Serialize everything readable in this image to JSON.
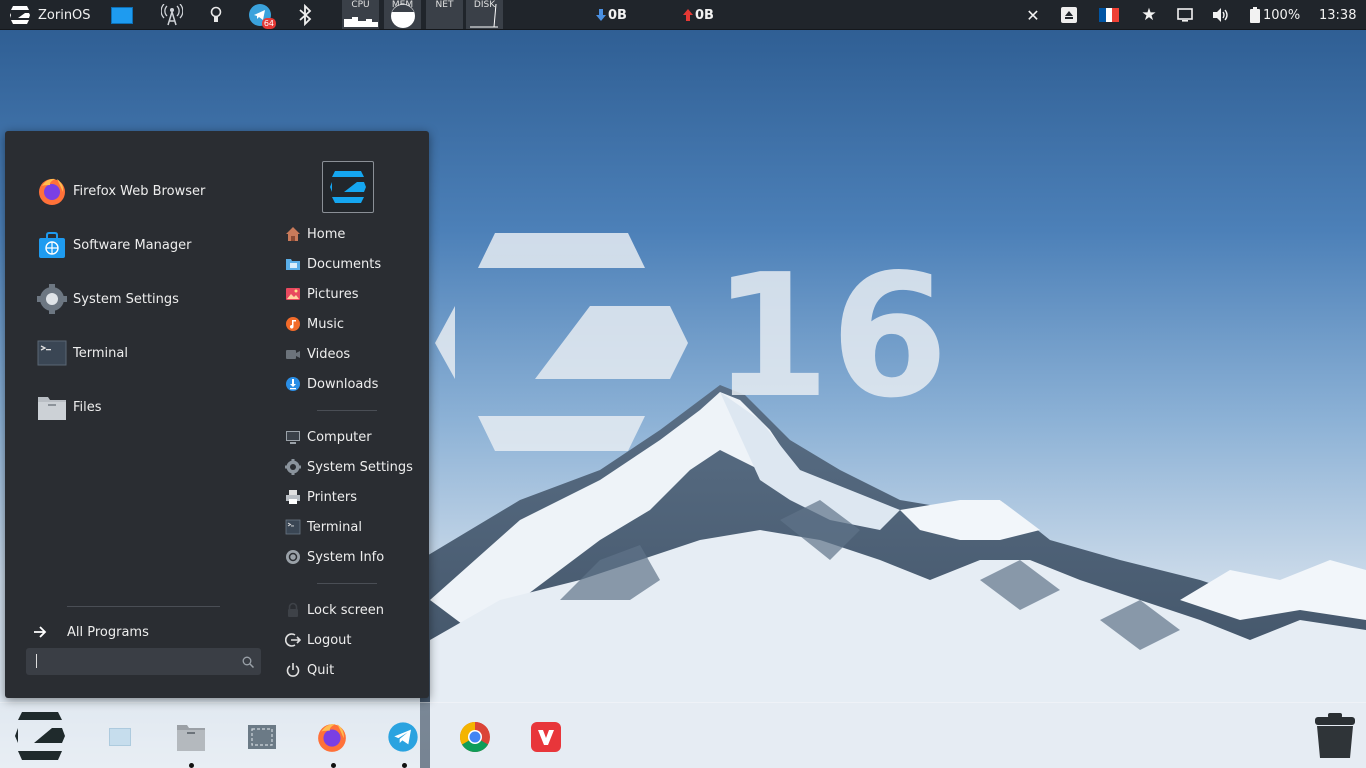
{
  "top_panel": {
    "menu_button_label": "ZorinOS",
    "monitors": [
      "CPU",
      "MEM",
      "NET",
      "DISK"
    ],
    "download_speed": "0B",
    "upload_speed": "0B",
    "telegram_badge": "64",
    "battery": "100%",
    "clock": "13:38"
  },
  "menu": {
    "favorites": [
      {
        "label": "Firefox Web Browser",
        "icon": "firefox-icon"
      },
      {
        "label": "Software Manager",
        "icon": "software-manager-icon"
      },
      {
        "label": "System Settings",
        "icon": "settings-gear-icon"
      },
      {
        "label": "Terminal",
        "icon": "terminal-icon"
      },
      {
        "label": "Files",
        "icon": "folder-icon"
      }
    ],
    "places": [
      {
        "label": "Home",
        "icon": "home-icon"
      },
      {
        "label": "Documents",
        "icon": "documents-icon"
      },
      {
        "label": "Pictures",
        "icon": "pictures-icon"
      },
      {
        "label": "Music",
        "icon": "music-icon"
      },
      {
        "label": "Videos",
        "icon": "videos-icon"
      },
      {
        "label": "Downloads",
        "icon": "downloads-icon"
      }
    ],
    "system": [
      {
        "label": "Computer",
        "icon": "computer-icon"
      },
      {
        "label": "System Settings",
        "icon": "settings-icon"
      },
      {
        "label": "Printers",
        "icon": "printer-icon"
      },
      {
        "label": "Terminal",
        "icon": "terminal-icon"
      },
      {
        "label": "System Info",
        "icon": "system-info-icon"
      }
    ],
    "session": [
      {
        "label": "Lock screen",
        "icon": "lock-icon"
      },
      {
        "label": "Logout",
        "icon": "logout-icon"
      },
      {
        "label": "Quit",
        "icon": "power-icon"
      }
    ],
    "all_programs_label": "All Programs",
    "search_value": ""
  },
  "desktop": {
    "wallpaper_version": "16"
  },
  "dock": {
    "items": [
      "zorin-menu-icon",
      "show-desktop-icon",
      "files-icon",
      "screenshot-icon",
      "firefox-icon",
      "telegram-icon",
      "chrome-icon",
      "vivaldi-icon",
      "trash-icon"
    ]
  },
  "colors": {
    "panel_bg": "#20252b",
    "menu_bg": "#2a2d32",
    "accent": "#15a6f0"
  }
}
